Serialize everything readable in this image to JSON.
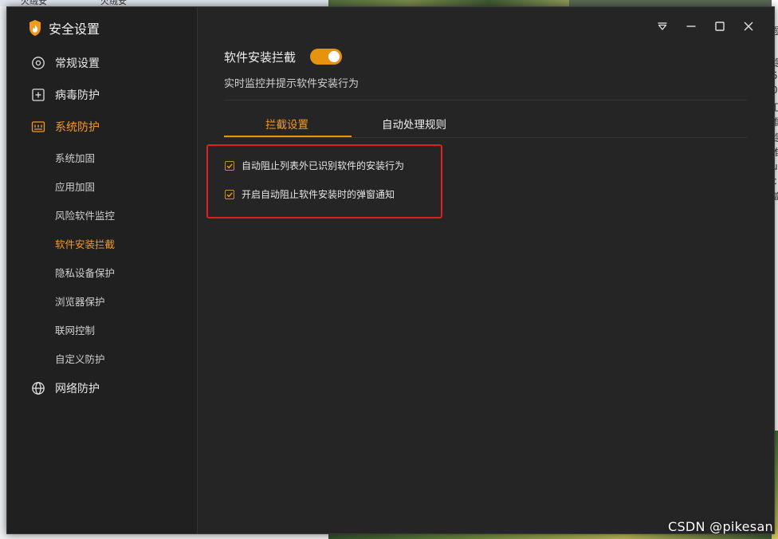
{
  "background": {
    "tab_texts": [
      "火绒安",
      "火绒安"
    ],
    "right_chars": [
      "题",
      "稳",
      "5",
      "0",
      "汇",
      "准",
      "稳",
      "推",
      "u",
      "c",
      "简",
      "-"
    ],
    "watermark": "CSDN @pikesan"
  },
  "app": {
    "title": "安全设置",
    "logo_icon": "huorong-flame-logo"
  },
  "window_controls": {
    "icons": [
      "menu-dropdown-icon",
      "minimize-icon",
      "maximize-icon",
      "close-icon"
    ]
  },
  "sidebar": {
    "items": [
      {
        "label": "常规设置",
        "icon": "settings-circle-icon"
      },
      {
        "label": "病毒防护",
        "icon": "plus-box-icon"
      },
      {
        "label": "系统防护",
        "icon": "system-protect-icon",
        "active": true
      },
      {
        "label": "网络防护",
        "icon": "globe-icon"
      }
    ],
    "sub_items": [
      {
        "label": "系统加固"
      },
      {
        "label": "应用加固"
      },
      {
        "label": "风险软件监控"
      },
      {
        "label": "软件安装拦截",
        "active": true
      },
      {
        "label": "隐私设备保护"
      },
      {
        "label": "浏览器保护"
      },
      {
        "label": "联网控制"
      },
      {
        "label": "自定义防护"
      }
    ]
  },
  "main": {
    "title": "软件安装拦截",
    "toggle_on": true,
    "subtitle": "实时监控并提示软件安装行为",
    "tabs": [
      {
        "label": "拦截设置",
        "active": true
      },
      {
        "label": "自动处理规则",
        "active": false
      }
    ],
    "options": [
      {
        "label": "自动阻止列表外已识别软件的安装行为",
        "checked": true
      },
      {
        "label": "开启自动阻止软件安装时的弹窗通知",
        "checked": true
      }
    ]
  },
  "colors": {
    "accent": "#f39b22",
    "window_bg": "#252525",
    "sidebar_bg": "#202020",
    "highlight_border": "#e02020"
  }
}
